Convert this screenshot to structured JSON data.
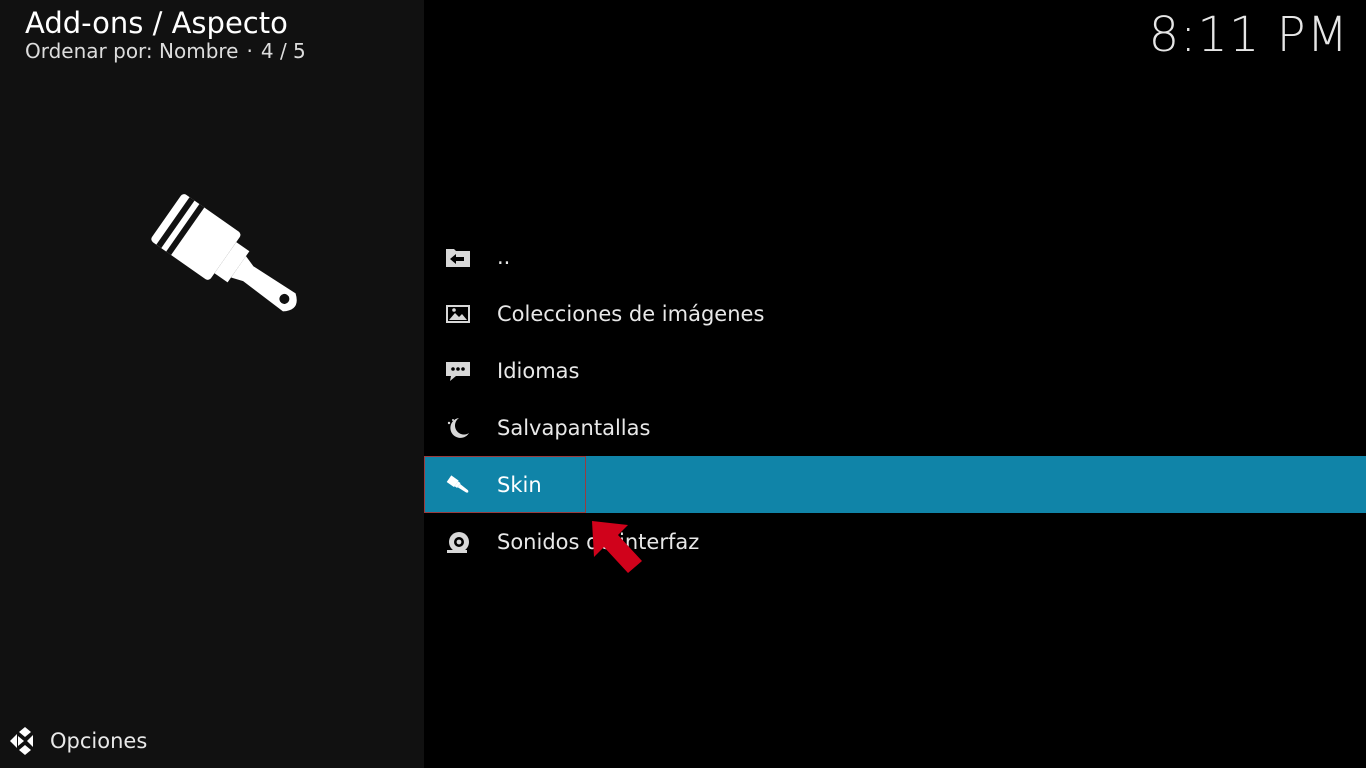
{
  "header": {
    "title": "Add-ons / Aspecto",
    "sort_label": "Ordenar por: Nombre",
    "separator": "·",
    "position": "4 / 5"
  },
  "clock": "8:11 PM",
  "list": {
    "items": [
      {
        "label": "..",
        "icon": "back-folder-icon"
      },
      {
        "label": "Colecciones de imágenes",
        "icon": "image-icon"
      },
      {
        "label": "Idiomas",
        "icon": "speech-bubble-icon"
      },
      {
        "label": "Salvapantallas",
        "icon": "moon-icon"
      },
      {
        "label": "Skin",
        "icon": "paintbrush-icon",
        "selected": true
      },
      {
        "label": "Sonidos de interfaz",
        "icon": "speaker-icon"
      }
    ]
  },
  "footer": {
    "options_label": "Opciones",
    "options_icon": "kodi-options-icon"
  },
  "colors": {
    "background": "#000000",
    "left_panel": "#111111",
    "selected_row": "#1084a8",
    "annotation_arrow": "#d0021b"
  }
}
